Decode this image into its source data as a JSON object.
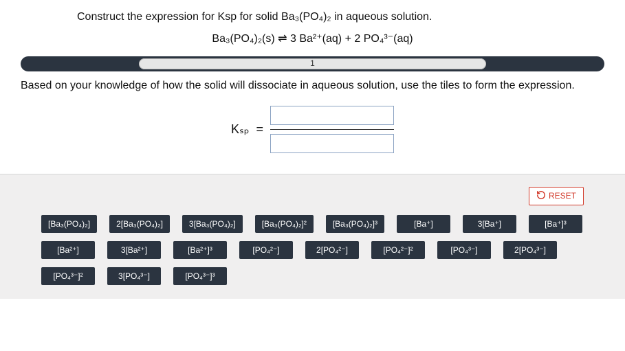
{
  "prompt": {
    "line1": "Construct the expression for Ksp for solid Ba₃(PO₄)₂ in aqueous solution.",
    "equation": "Ba₃(PO₄)₂(s) ⇌ 3 Ba²⁺(aq) + 2 PO₄³⁻(aq)"
  },
  "progress": {
    "step_label": "1"
  },
  "instructions": "Based on your knowledge of how the solid will dissociate in aqueous solution, use the tiles to form the expression.",
  "ksp": {
    "symbol": "Kₛₚ",
    "equals": "="
  },
  "reset_label": "RESET",
  "tiles": [
    "[Ba₃(PO₄)₂]",
    "2[Ba₃(PO₄)₂]",
    "3[Ba₃(PO₄)₂]",
    "[Ba₃(PO₄)₂]²",
    "[Ba₃(PO₄)₂]³",
    "[Ba⁺]",
    "3[Ba⁺]",
    "[Ba⁺]³",
    "[Ba²⁺]",
    "3[Ba²⁺]",
    "[Ba²⁺]³",
    "[PO₄²⁻]",
    "2[PO₄²⁻]",
    "[PO₄²⁻]²",
    "[PO₄³⁻]",
    "2[PO₄³⁻]",
    "[PO₄³⁻]²",
    "3[PO₄³⁻]",
    "[PO₄³⁻]³"
  ]
}
